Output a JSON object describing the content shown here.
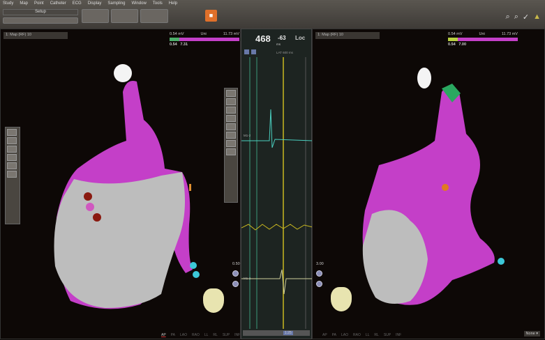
{
  "menu": [
    "Study",
    "Map",
    "Point",
    "Catheter",
    "ECG",
    "Display",
    "Sampling",
    "Window",
    "Tools",
    "Help"
  ],
  "toolbar": {
    "study_label": "Setup",
    "orange_icon": "record-icon",
    "right_icons": [
      "zoom-icon",
      "zoom-out-icon",
      "checkmark-icon",
      "warning-icon"
    ]
  },
  "left_map": {
    "title": "1: Map (RF) 10",
    "scale_min": "0.54 mV",
    "scale_label": "Uni",
    "scale_max": "11.73 mV",
    "low": "0.54",
    "high": "7.31",
    "zoom": "0.50",
    "view": "AP",
    "view_label": "AP"
  },
  "right_map": {
    "title": "1: Map (RF) 10",
    "scale_min": "0.54 mV",
    "scale_label": "Uni",
    "scale_max": "11.73 mV",
    "low": "0.54",
    "high": "7.00",
    "zoom": "3.00",
    "view_label": "LAO",
    "dropdown": "None"
  },
  "ecg": {
    "cycle": "468",
    "lat": "-63",
    "lat_unit": "ms",
    "mode": "Loc",
    "sub_label": "LAT 600 ms",
    "channel_top": "M1-2",
    "channel_bottom": "M1-2",
    "timer": "1:25"
  },
  "colors": {
    "magenta": "#c43fc8",
    "gray": "#bdbdbd",
    "accent": "#e0702a"
  }
}
